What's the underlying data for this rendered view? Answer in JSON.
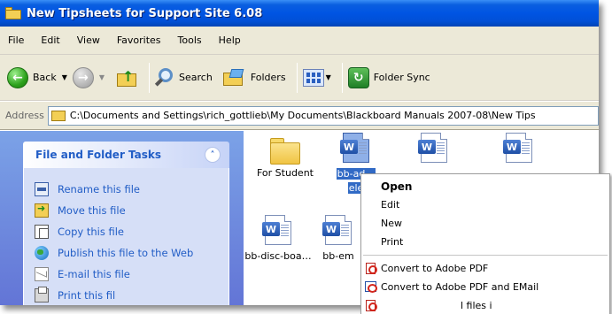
{
  "window": {
    "title": "New Tipsheets for Support Site 6.08"
  },
  "menu": [
    "File",
    "Edit",
    "View",
    "Favorites",
    "Tools",
    "Help"
  ],
  "toolbar": {
    "back_label": "Back",
    "search_label": "Search",
    "folders_label": "Folders",
    "folder_sync_label": "Folder Sync"
  },
  "address": {
    "label": "Address",
    "path": "C:\\Documents and Settings\\rich_gottlieb\\My Documents\\Blackboard Manuals 2007-08\\New Tips"
  },
  "tasks": {
    "title": "File and Folder Tasks",
    "collapse_symbol": "˄",
    "items": [
      {
        "label": "Rename this file",
        "icon": "rename-icon"
      },
      {
        "label": "Move this file",
        "icon": "move-icon"
      },
      {
        "label": "Copy this file",
        "icon": "copy-icon"
      },
      {
        "label": "Publish this file to the Web",
        "icon": "publish-web-icon"
      },
      {
        "label": "E-mail this file",
        "icon": "email-icon"
      },
      {
        "label": "Print this fil",
        "icon": "print-icon"
      }
    ]
  },
  "files": [
    {
      "name": "For Student",
      "type": "folder"
    },
    {
      "name": "bb-ad…",
      "name_line2": "ele",
      "type": "word",
      "selected": true
    },
    {
      "name": "",
      "type": "word"
    },
    {
      "name": "",
      "type": "word"
    },
    {
      "name": "bb-disc-boa…",
      "type": "word"
    },
    {
      "name": "bb-em",
      "type": "word"
    }
  ],
  "context_menu": {
    "items": [
      {
        "label": "Open",
        "bold": true
      },
      {
        "label": "Edit"
      },
      {
        "label": "New"
      },
      {
        "label": "Print"
      },
      {
        "separator": true
      },
      {
        "label": "Convert to Adobe PDF",
        "icon": "pdf-icon"
      },
      {
        "label": "Convert to Adobe PDF and EMail",
        "icon": "pdf-email-icon"
      },
      {
        "label": "",
        "icon": "pdf-icon"
      }
    ],
    "partial_text": "l files i"
  },
  "colors": {
    "titlebar": "#0054e3",
    "task_pane": "#6f8cde",
    "task_link": "#215dc6",
    "selection": "#316ac5"
  }
}
